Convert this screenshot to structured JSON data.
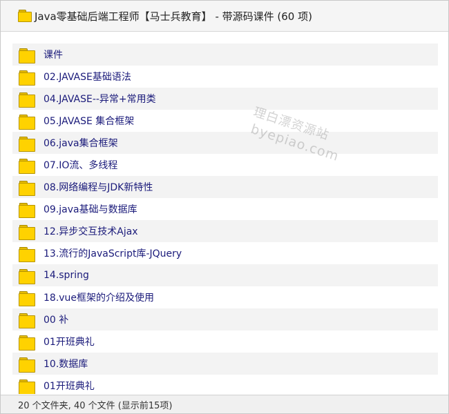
{
  "window": {
    "title": "Java零基础后端工程师【马士兵教育】 - 带源码课件 (60 项)"
  },
  "list": {
    "items": [
      {
        "name": "课件",
        "icon": "folder-icon"
      },
      {
        "name": "02.JAVASE基础语法",
        "icon": "folder-icon"
      },
      {
        "name": "04.JAVASE--异常+常用类",
        "icon": "folder-icon"
      },
      {
        "name": "05.JAVASE 集合框架",
        "icon": "folder-icon"
      },
      {
        "name": "06.java集合框架",
        "icon": "folder-icon"
      },
      {
        "name": "07.IO流、多线程",
        "icon": "folder-icon"
      },
      {
        "name": "08.网络编程与JDK新特性",
        "icon": "folder-icon"
      },
      {
        "name": "09.java基础与数据库",
        "icon": "folder-icon"
      },
      {
        "name": "12.异步交互技术Ajax",
        "icon": "folder-icon"
      },
      {
        "name": "13.流行的JavaScript库-JQuery",
        "icon": "folder-icon"
      },
      {
        "name": "14.spring",
        "icon": "folder-icon"
      },
      {
        "name": "18.vue框架的介绍及使用",
        "icon": "folder-icon"
      },
      {
        "name": "00 补",
        "icon": "folder-icon"
      },
      {
        "name": "01开班典礼",
        "icon": "folder-icon"
      },
      {
        "name": "10.数据库",
        "icon": "folder-icon"
      },
      {
        "name": "01开班典礼",
        "icon": "folder-icon"
      }
    ]
  },
  "watermark": {
    "line1": "理白漂资源站",
    "line2": "byepiao.com"
  },
  "status": {
    "text": "20 个文件夹, 40 个文件 (显示前15项)"
  },
  "colors": {
    "folder_fill": "#ffd200",
    "folder_border": "#b59300",
    "row_alt_bg": "#f3f3f3",
    "item_text": "#1a1a7a",
    "titlebar_bg": "#f5f5f5",
    "statusbar_bg": "#f0f0f0"
  }
}
